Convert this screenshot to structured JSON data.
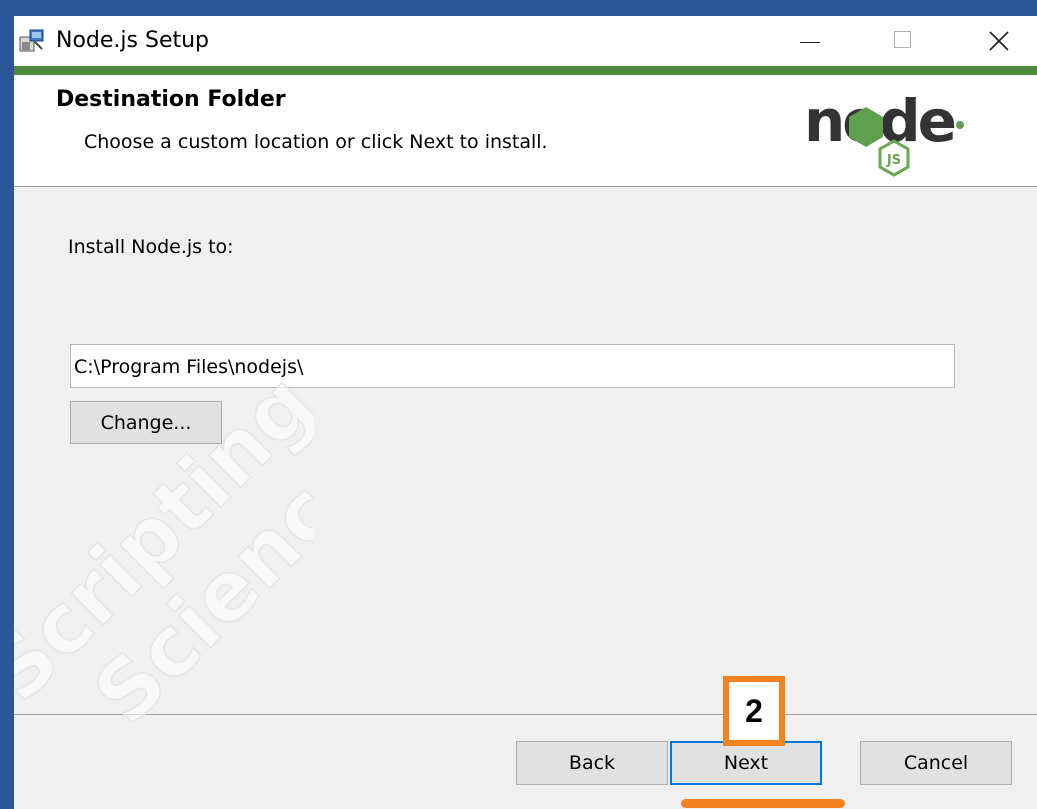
{
  "window": {
    "title": "Node.js Setup",
    "controls": [
      "minimize-icon",
      "maximize-icon",
      "close-icon"
    ]
  },
  "header": {
    "title": "Destination Folder",
    "subtitle": "Choose a custom location or click Next to install.",
    "logo_text": "node",
    "logo_badge": "JS"
  },
  "main": {
    "install_label": "Install Node.js to:",
    "install_path": "C:\\Program Files\\nodejs\\",
    "change_label": "Change..."
  },
  "footer": {
    "back_label": "Back",
    "next_label": "Next",
    "cancel_label": "Cancel"
  },
  "annotation": {
    "step_number": "2",
    "color": "#f58220"
  },
  "watermark": {
    "line1": "Scripting",
    "line2": "Science"
  },
  "colors": {
    "accent_green": "#4b8b3b",
    "focus_blue": "#0078d7",
    "desktop_blue": "#2b5797"
  }
}
